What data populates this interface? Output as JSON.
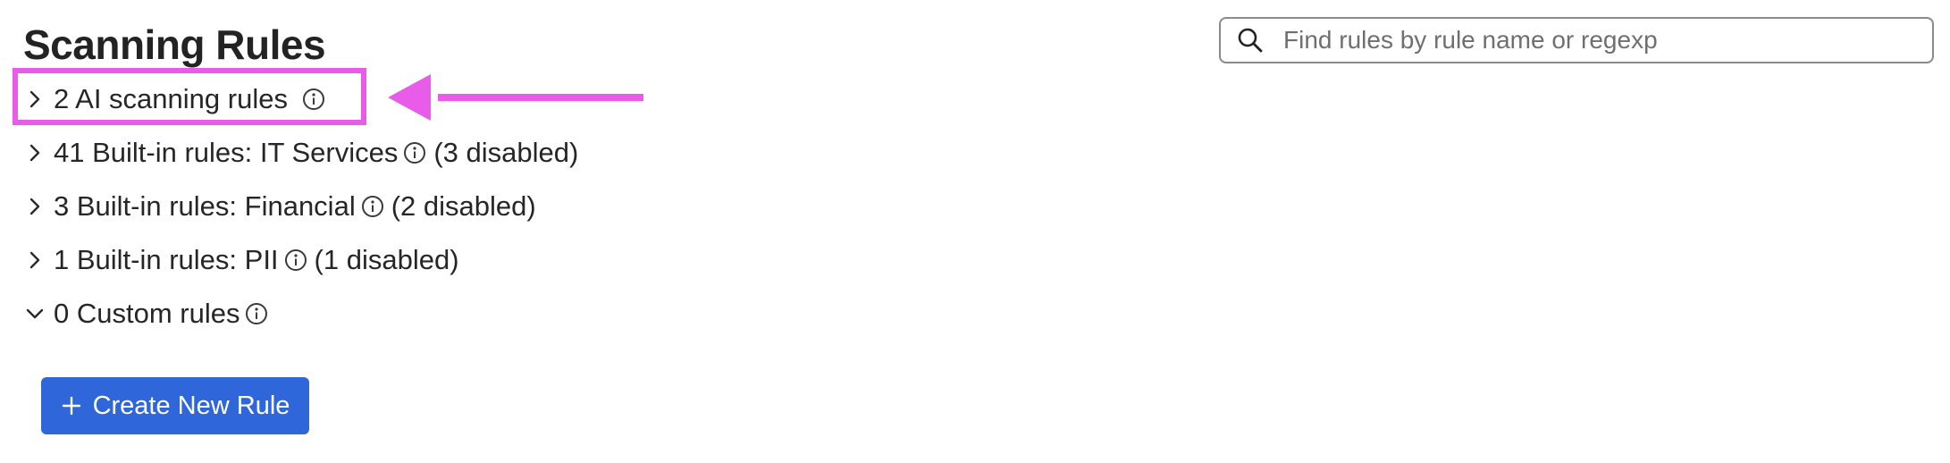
{
  "page": {
    "title": "Scanning Rules"
  },
  "search": {
    "placeholder": "Find rules by rule name or regexp",
    "icon": "search-icon"
  },
  "rule_groups": [
    {
      "label": "2 AI scanning rules",
      "suffix": "",
      "expanded": false,
      "icon": "info-icon"
    },
    {
      "label": "41 Built-in rules: IT Services",
      "suffix": "(3 disabled)",
      "expanded": false,
      "icon": "info-icon"
    },
    {
      "label": "3 Built-in rules: Financial",
      "suffix": "(2 disabled)",
      "expanded": false,
      "icon": "info-icon"
    },
    {
      "label": "1 Built-in rules: PII",
      "suffix": "(1 disabled)",
      "expanded": false,
      "icon": "info-icon"
    },
    {
      "label": "0 Custom rules",
      "suffix": "",
      "expanded": true,
      "icon": "info-icon"
    }
  ],
  "actions": {
    "create_label": "Create New Rule"
  },
  "colors": {
    "primary_button": "#2f66da",
    "highlight": "#e95be9",
    "text": "#262626"
  }
}
